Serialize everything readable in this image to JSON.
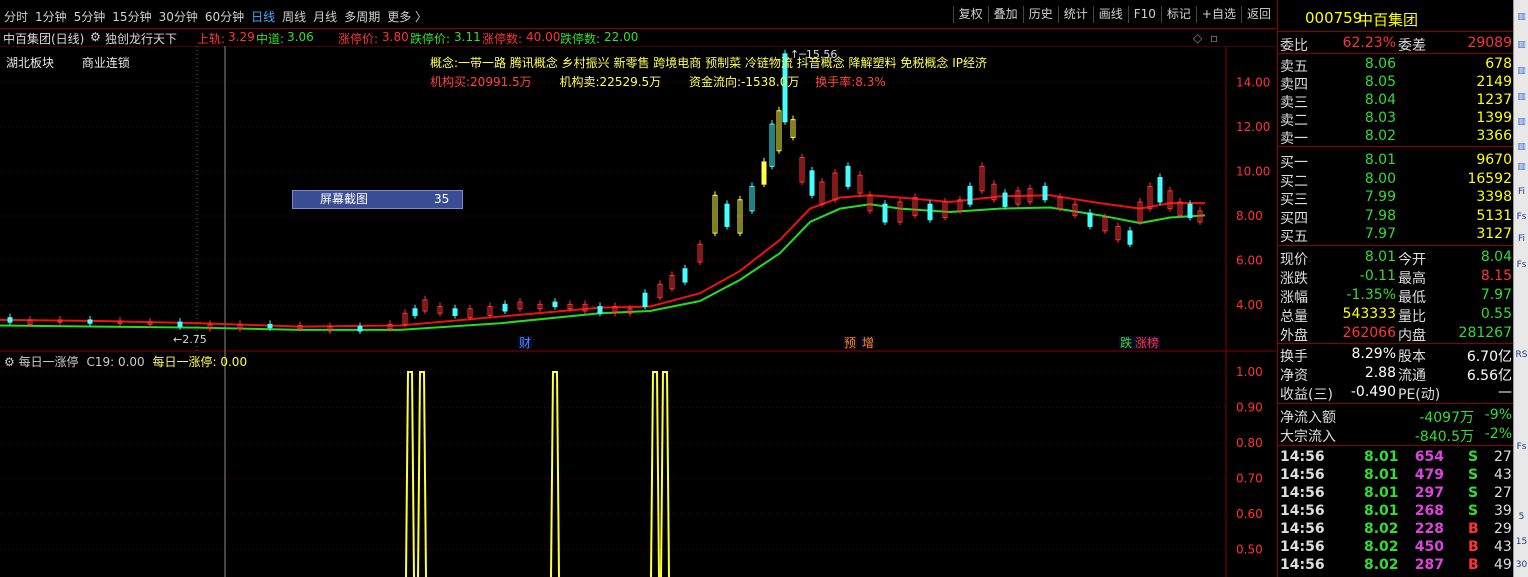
{
  "toolbar": {
    "periods": [
      "分时",
      "1分钟",
      "5分钟",
      "15分钟",
      "30分钟",
      "60分钟",
      "日线",
      "周线",
      "月线",
      "多周期",
      "更多 〉"
    ],
    "active_period": "日线",
    "tools": [
      "复权",
      "叠加",
      "历史",
      "统计",
      "画线",
      "F10",
      "标记",
      "+自选",
      "返回"
    ]
  },
  "info": {
    "stock": "中百集团(日线)",
    "indicator": "独创龙行天下",
    "upper_label": "上轨:",
    "upper_val": "3.29",
    "mid_label": "中道:",
    "mid_val": "3.06",
    "limitup_price_label": "涨停价:",
    "limitup_price": "3.80",
    "limitdown_price_label": "跌停价:",
    "limitdown_price": "3.11",
    "limitup_count_label": "涨停数:",
    "limitup_count": "40.00",
    "limitdown_count_label": "跌停数:",
    "limitdown_count": "22.00"
  },
  "tags": {
    "region": "湖北板块",
    "industry": "商业连锁"
  },
  "concepts": "概念:一带一路 腾讯概念 乡村振兴 新零售 跨境电商 预制菜 冷链物流 抖音概念 降解塑料 免税概念 IP经济",
  "institutions": {
    "buy": "机构买:20991.5万",
    "sell": "机构卖:22529.5万",
    "flow": "资金流向:-1538.0万",
    "turnover": "换手率:8.3%"
  },
  "screenshot_box": {
    "label": "屏幕截图",
    "value": "35"
  },
  "chart_data": [
    {
      "type": "candlestick",
      "yticks": [
        "14.00",
        "12.00",
        "10.00",
        "8.00",
        "6.00",
        "4.00"
      ],
      "ylim": [
        2.0,
        16.0
      ],
      "annotations": {
        "high": "15.56",
        "low": "2.75"
      },
      "event_markers": [
        {
          "label": "财",
          "color": "#4a8cff"
        },
        {
          "label": "预",
          "color": "#ff8800"
        },
        {
          "label": "增",
          "color": "#ff8800"
        },
        {
          "label": "跌",
          "color": "#33dd33"
        },
        {
          "label": "涨榜",
          "color": "#ff3333"
        }
      ]
    },
    {
      "type": "bar",
      "title": "每日一涨停",
      "series_label_1": "C19: 0.00",
      "series_label_2": "每日一涨停: 0.00",
      "yticks": [
        "1.00",
        "0.90",
        "0.80",
        "0.70",
        "0.60",
        "0.50"
      ],
      "ylim": [
        0.45,
        1.05
      ]
    }
  ],
  "quote": {
    "code": "000759",
    "name": "中百集团",
    "weibi_label": "委比",
    "weibi": "62.23%",
    "weicha_label": "委差",
    "weicha": "29089",
    "asks": [
      {
        "label": "卖五",
        "price": "8.06",
        "vol": "678"
      },
      {
        "label": "卖四",
        "price": "8.05",
        "vol": "2149"
      },
      {
        "label": "卖三",
        "price": "8.04",
        "vol": "1237"
      },
      {
        "label": "卖二",
        "price": "8.03",
        "vol": "1399"
      },
      {
        "label": "卖一",
        "price": "8.02",
        "vol": "3366"
      }
    ],
    "bids": [
      {
        "label": "买一",
        "price": "8.01",
        "vol": "9670"
      },
      {
        "label": "买二",
        "price": "8.00",
        "vol": "16592"
      },
      {
        "label": "买三",
        "price": "7.99",
        "vol": "3398"
      },
      {
        "label": "买四",
        "price": "7.98",
        "vol": "5131"
      },
      {
        "label": "买五",
        "price": "7.97",
        "vol": "3127"
      }
    ],
    "stats": [
      {
        "l1": "现价",
        "v1": "8.01",
        "c1": "#33dd33",
        "l2": "今开",
        "v2": "8.04",
        "c2": "#33dd33"
      },
      {
        "l1": "涨跌",
        "v1": "-0.11",
        "c1": "#33dd33",
        "l2": "最高",
        "v2": "8.15",
        "c2": "#ff3333"
      },
      {
        "l1": "涨幅",
        "v1": "-1.35%",
        "c1": "#33dd33",
        "l2": "最低",
        "v2": "7.97",
        "c2": "#33dd33"
      },
      {
        "l1": "总量",
        "v1": "543333",
        "c1": "#ffff00",
        "l2": "量比",
        "v2": "0.55",
        "c2": "#33dd33"
      },
      {
        "l1": "外盘",
        "v1": "262066",
        "c1": "#ff3333",
        "l2": "内盘",
        "v2": "281267",
        "c2": "#33dd33"
      }
    ],
    "fund": [
      {
        "l1": "换手",
        "v1": "8.29%",
        "l2": "股本",
        "v2": "6.70亿"
      },
      {
        "l1": "净资",
        "v1": "2.88",
        "l2": "流通",
        "v2": "6.56亿"
      },
      {
        "l1": "收益(三)",
        "v1": "-0.490",
        "l2": "PE(动)",
        "v2": "—"
      }
    ],
    "flow": [
      {
        "label": "净流入额",
        "val": "-4097万",
        "pct": "-9%"
      },
      {
        "label": "大宗流入",
        "val": "-840.5万",
        "pct": "-2%"
      }
    ],
    "ticks": [
      {
        "t": "14:56",
        "p": "8.01",
        "v": "654",
        "s": "S",
        "n": "27"
      },
      {
        "t": "14:56",
        "p": "8.01",
        "v": "479",
        "s": "S",
        "n": "43"
      },
      {
        "t": "14:56",
        "p": "8.01",
        "v": "297",
        "s": "S",
        "n": "27"
      },
      {
        "t": "14:56",
        "p": "8.01",
        "v": "268",
        "s": "S",
        "n": "39"
      },
      {
        "t": "14:56",
        "p": "8.02",
        "v": "228",
        "s": "B",
        "n": "29"
      },
      {
        "t": "14:56",
        "p": "8.02",
        "v": "450",
        "s": "B",
        "n": "43"
      },
      {
        "t": "14:56",
        "p": "8.02",
        "v": "287",
        "s": "B",
        "n": "49"
      }
    ]
  },
  "sidebar": [
    "Fi",
    "Fs",
    "Fi",
    "Fs",
    "RS",
    "Fs",
    "5",
    "15",
    "30"
  ]
}
